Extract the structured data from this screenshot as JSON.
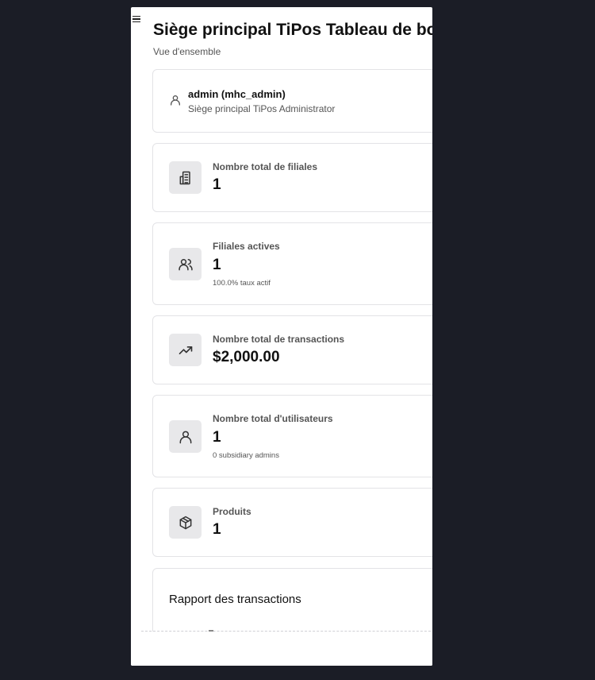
{
  "header": {
    "title": "Siège principal TiPos Tableau de bord",
    "subtitle": "Vue d'ensemble"
  },
  "user": {
    "name": "admin (mhc_admin)",
    "role": "Siège principal TiPos Administrator"
  },
  "stats": [
    {
      "label": "Nombre total de filiales",
      "value": "1",
      "sub": "",
      "icon": "building-icon"
    },
    {
      "label": "Filiales actives",
      "value": "1",
      "sub": "100.0% taux actif",
      "icon": "users-icon"
    },
    {
      "label": "Nombre total de transactions",
      "value": "$2,000.00",
      "sub": "",
      "icon": "trending-up-icon"
    },
    {
      "label": "Nombre total d'utilisateurs",
      "value": "1",
      "sub": "0 subsidiary admins",
      "icon": "user-icon"
    },
    {
      "label": "Produits",
      "value": "1",
      "sub": "",
      "icon": "package-icon"
    }
  ],
  "report": {
    "title": "Rapport des transactions"
  }
}
